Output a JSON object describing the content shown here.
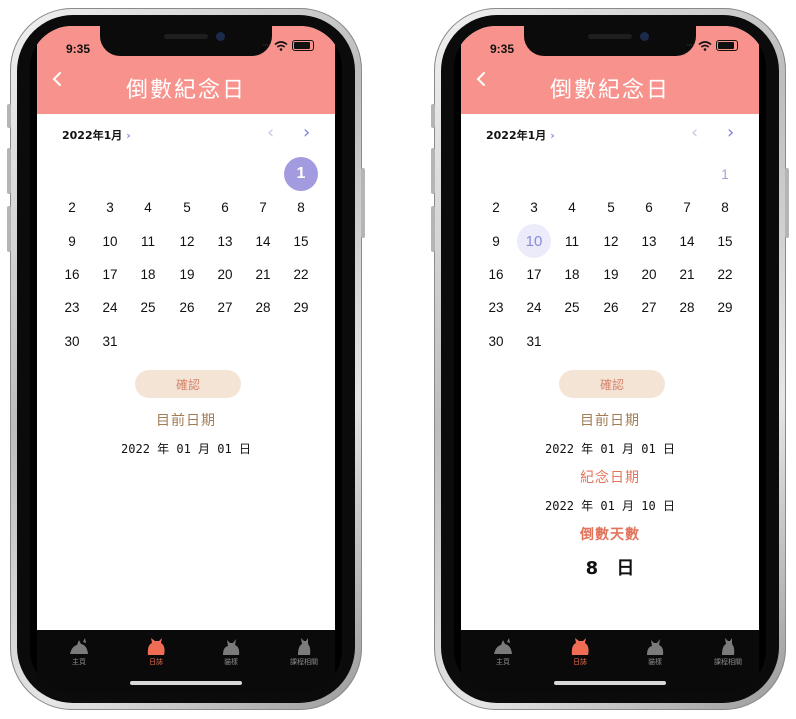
{
  "phones": [
    {
      "status_time": "9:35",
      "header": {
        "back_icon": "chevron-left-icon",
        "title": "倒數紀念日"
      },
      "calendar": {
        "month_label": "2022年1月",
        "days": [
          "1",
          "2",
          "3",
          "4",
          "5",
          "6",
          "7",
          "8",
          "9",
          "10",
          "11",
          "12",
          "13",
          "14",
          "15",
          "16",
          "17",
          "18",
          "19",
          "20",
          "21",
          "22",
          "23",
          "24",
          "25",
          "26",
          "27",
          "28",
          "29",
          "30",
          "31"
        ],
        "selected_day": "1"
      },
      "confirm_label": "確認",
      "current_date_label": "目前日期",
      "current_date": "2022 年 01 月 01 日",
      "tabs": [
        {
          "label": "主頁",
          "icon": "cat-icon"
        },
        {
          "label": "日誌",
          "icon": "cat-icon",
          "active": true
        },
        {
          "label": "貓樣",
          "icon": "cat-icon"
        },
        {
          "label": "課程相關",
          "icon": "cat-icon"
        }
      ]
    },
    {
      "status_time": "9:35",
      "header": {
        "back_icon": "chevron-left-icon",
        "title": "倒數紀念日"
      },
      "calendar": {
        "month_label": "2022年1月",
        "days": [
          "1",
          "2",
          "3",
          "4",
          "5",
          "6",
          "7",
          "8",
          "9",
          "10",
          "11",
          "12",
          "13",
          "14",
          "15",
          "16",
          "17",
          "18",
          "19",
          "20",
          "21",
          "22",
          "23",
          "24",
          "25",
          "26",
          "27",
          "28",
          "29",
          "30",
          "31"
        ],
        "selected_day": "10"
      },
      "confirm_label": "確認",
      "current_date_label": "目前日期",
      "current_date": "2022 年 01 月 01 日",
      "anniversary_label": "紀念日期",
      "anniversary_date": "2022 年 01 月 10 日",
      "countdown_label": "倒數天數",
      "countdown_value": "8",
      "countdown_unit": "日",
      "tabs": [
        {
          "label": "主頁",
          "icon": "cat-icon"
        },
        {
          "label": "日誌",
          "icon": "cat-icon",
          "active": true
        },
        {
          "label": "貓樣",
          "icon": "cat-icon"
        },
        {
          "label": "課程相關",
          "icon": "cat-icon"
        }
      ]
    }
  ],
  "colors": {
    "header": "#f8928c",
    "accent_purple": "#a39be0",
    "confirm_bg": "#f4e4d6",
    "label_brown": "#a27c55",
    "label_red": "#e2745c",
    "tab_active": "#ef6d55"
  }
}
